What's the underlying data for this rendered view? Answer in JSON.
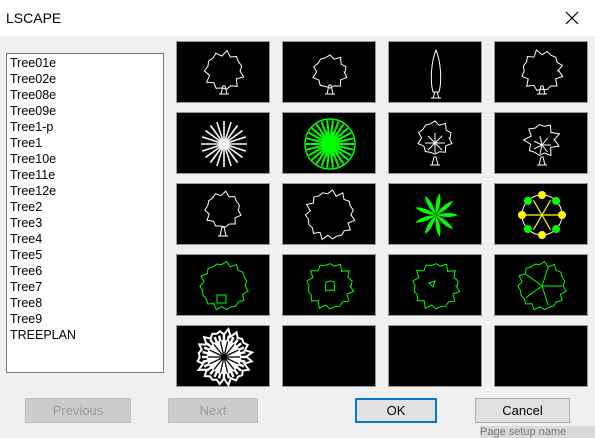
{
  "window": {
    "title": "LSCAPE"
  },
  "list": {
    "items": [
      "Tree01e",
      "Tree02e",
      "Tree08e",
      "Tree09e",
      "Tree1-p",
      "Tree1",
      "Tree10e",
      "Tree11e",
      "Tree12e",
      "Tree2",
      "Tree3",
      "Tree4",
      "Tree5",
      "Tree6",
      "Tree7",
      "Tree8",
      "Tree9",
      "TREEPLAN"
    ]
  },
  "buttons": {
    "previous": "Previous",
    "next": "Next",
    "ok": "OK",
    "cancel": "Cancel"
  },
  "background_text": "Page setup name",
  "colors": {
    "tile_bg": "#000000",
    "outline_white": "#ffffff",
    "outline_green": "#00ff00",
    "accent_yellow": "#ffff00",
    "focus": "#0078d7"
  },
  "tiles": [
    "tree-outline-icon",
    "tree-outline-icon",
    "cypress-outline-icon",
    "tree-outline-icon",
    "tree-plan-branches-icon",
    "tree-plan-green-canopy-icon",
    "tree-branches-icon",
    "tree-branches-icon",
    "tree-branches-icon",
    "tree-plan-outline-icon",
    "palm-plan-green-icon",
    "tree-plan-yellow-green-icon",
    "tree-plan-green-outline-icon",
    "tree-plan-green-outline-icon",
    "tree-plan-green-outline-icon",
    "tree-plan-green-outline-icon",
    "tree-plan-white-canopy-icon",
    "empty-slot",
    "empty-slot",
    "empty-slot"
  ]
}
